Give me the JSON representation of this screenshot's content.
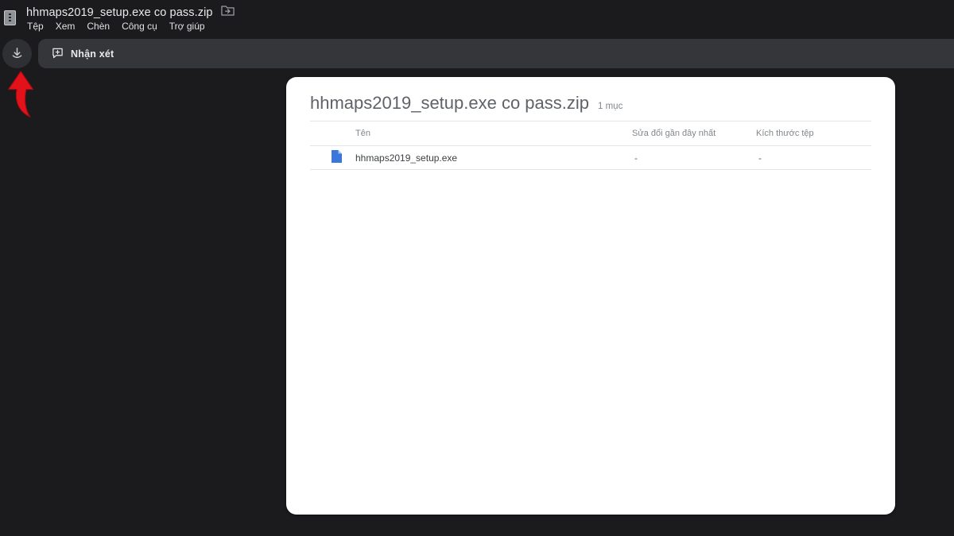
{
  "header": {
    "title": "hhmaps2019_setup.exe co pass.zip",
    "menu": [
      {
        "label": "Tệp"
      },
      {
        "label": "Xem"
      },
      {
        "label": "Chèn"
      },
      {
        "label": "Công cụ"
      },
      {
        "label": "Trợ giúp"
      }
    ]
  },
  "toolbar": {
    "comment_label": "Nhận xét"
  },
  "annotation": {
    "arrow_color": "#e3121a"
  },
  "card": {
    "title": "hhmaps2019_setup.exe co pass.zip",
    "item_count": "1 mục",
    "table": {
      "headers": {
        "name": "Tên",
        "modified": "Sửa đổi gần đây nhất",
        "size": "Kích thước tệp"
      },
      "rows": [
        {
          "name": "hhmaps2019_setup.exe",
          "modified": "-",
          "size": "-"
        }
      ]
    }
  },
  "colors": {
    "page_bg": "#1b1b1d",
    "toolbar_bg": "#35363a",
    "card_bg": "#ffffff",
    "file_icon_blue": "#3b77db",
    "arrow_red": "#e3121a",
    "title_text": "#e8eaed",
    "card_title_text": "#5f6368"
  }
}
